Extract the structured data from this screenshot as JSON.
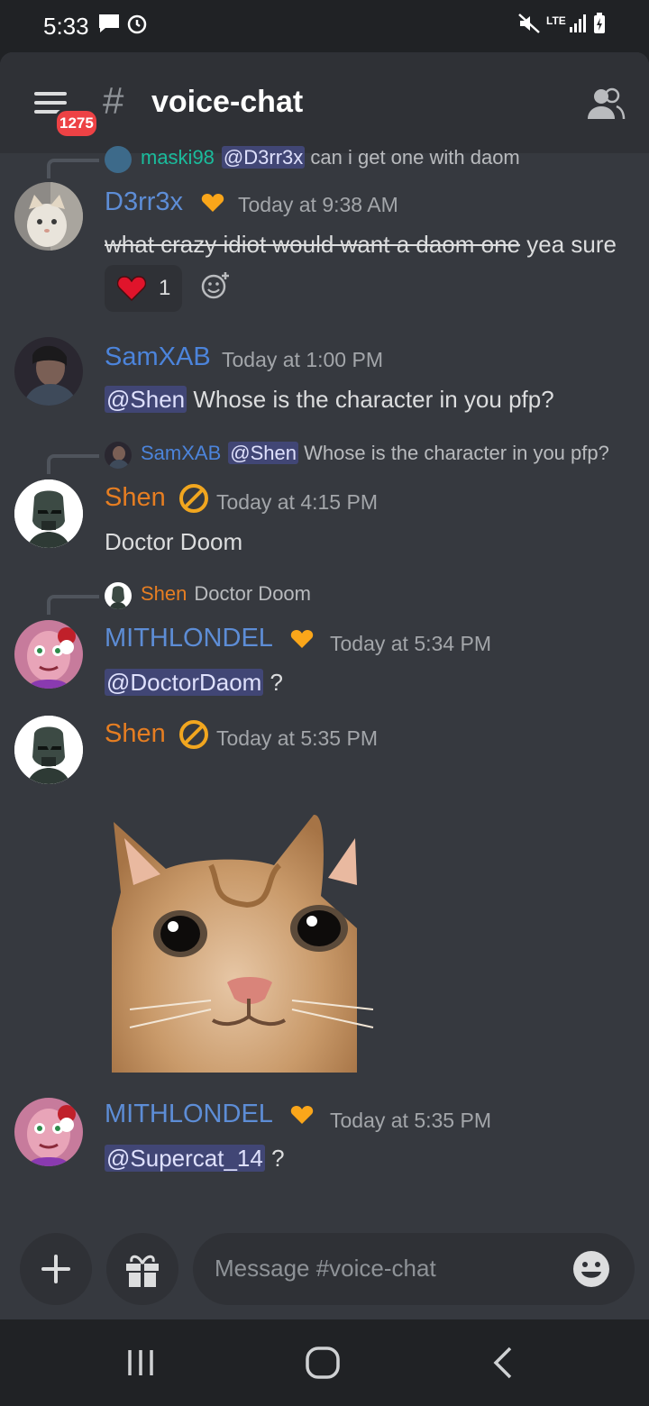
{
  "status_bar": {
    "time": "5:33",
    "network": "LTE"
  },
  "header": {
    "badge_count": "1275",
    "hash": "#",
    "channel": "voice-chat"
  },
  "messages": [
    {
      "reply": {
        "user": "maski98",
        "mention": "@D3rr3x",
        "text": "can i get one with daom"
      },
      "author": "D3rr3x",
      "author_color": "#5d8dd6",
      "timestamp": "Today at 9:38 AM",
      "strike_text": "what crazy idiot would want a daom one",
      "text": " yea sure",
      "reaction": {
        "emoji": "heart",
        "count": "1"
      }
    },
    {
      "author": "SamXAB",
      "author_color": "#4c84db",
      "timestamp": "Today at 1:00 PM",
      "mention": "@Shen",
      "text": " Whose is the character in you pfp?"
    },
    {
      "reply": {
        "user": "SamXAB",
        "mention": "@Shen",
        "text": "Whose is the character in you pfp?"
      },
      "author": "Shen",
      "author_color": "#e67e22",
      "timestamp": "Today at 4:15 PM",
      "text": "Doctor Doom"
    },
    {
      "reply": {
        "user": "Shen",
        "text": "Doctor Doom"
      },
      "author": "MITHLONDEL",
      "author_color": "#5d8dd6",
      "timestamp": "Today at 5:34 PM",
      "mention": "@DoctorDaom",
      "text": " ?"
    },
    {
      "author": "Shen",
      "author_color": "#e67e22",
      "timestamp": "Today at 5:35 PM",
      "image": "cat-closeup"
    },
    {
      "author": "MITHLONDEL",
      "author_color": "#5d8dd6",
      "timestamp": "Today at 5:35 PM",
      "mention": "@Supercat_14",
      "text": " ?"
    }
  ],
  "composer": {
    "placeholder": "Message #voice-chat"
  },
  "icons": {
    "menu": "hamburger-icon",
    "members": "members-icon",
    "add": "plus-icon",
    "gift": "gift-icon",
    "emoji": "smiley-icon",
    "nav_recents": "recents-icon",
    "nav_home": "home-icon",
    "nav_back": "back-icon"
  }
}
